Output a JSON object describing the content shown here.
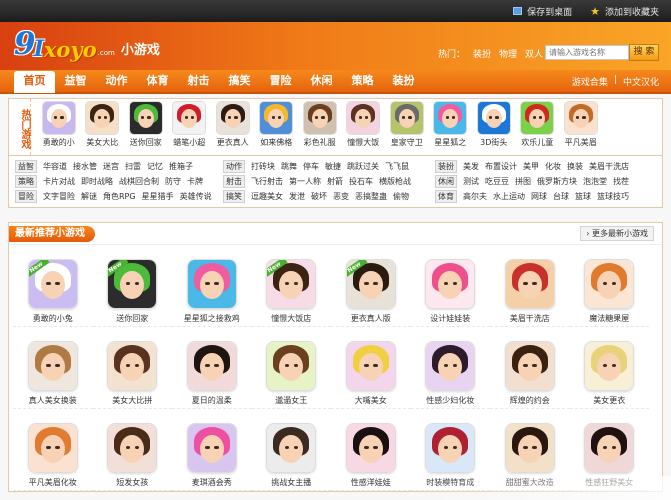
{
  "topbar": {
    "save_desktop": "保存到桌面",
    "add_favorite": "添加到收藏夹"
  },
  "logo": {
    "cn": "小游戏",
    "com": ".com"
  },
  "header": {
    "hot_label": "热门：",
    "hot_links": [
      "装扮",
      "物理",
      "双人"
    ],
    "search_placeholder": "请输入游戏名称",
    "search_button": "搜 索"
  },
  "nav": {
    "items": [
      "首页",
      "益智",
      "动作",
      "体育",
      "射击",
      "搞笑",
      "冒险",
      "休闲",
      "策略",
      "装扮"
    ],
    "right": [
      "游戏合集",
      "中文汉化"
    ]
  },
  "hot_title": "热门游戏",
  "hot_games": [
    {
      "name": "勇敢的小",
      "bg": "#c9b8f0",
      "hair": "#ffffff"
    },
    {
      "name": "美女大比",
      "bg": "#f4e0c8",
      "hair": "#3b2414"
    },
    {
      "name": "送你回家",
      "bg": "#2b2b2b",
      "hair": "#4dbb3a"
    },
    {
      "name": "蜡笔小超",
      "bg": "#f2f2f2",
      "hair": "#d21b2b"
    },
    {
      "name": "更衣真人",
      "bg": "#e9e2da",
      "hair": "#2d1a10"
    },
    {
      "name": "如来佛格",
      "bg": "#4e8fd8",
      "hair": "#f5b82a"
    },
    {
      "name": "彩色礼服",
      "bg": "#d0c0b0",
      "hair": "#6b3e20"
    },
    {
      "name": "憧憬大饭",
      "bg": "#f3d3e0",
      "hair": "#5a3420"
    },
    {
      "name": "皇家守卫",
      "bg": "#b5c36a",
      "hair": "#6a6a6a"
    },
    {
      "name": "星星狐之",
      "bg": "#4bb9e8",
      "hair": "#ef5da0"
    },
    {
      "name": "3D街头",
      "bg": "#1b78d6",
      "hair": "#ffffff"
    },
    {
      "name": "欢乐儿童",
      "bg": "#7dd14a",
      "hair": "#d2291f"
    },
    {
      "name": "平凡美眉",
      "bg": "#fbe2d0",
      "hair": "#c46a28"
    }
  ],
  "categories": [
    [
      {
        "tag": "益智",
        "links": [
          "华容道",
          "接水管",
          "迷宫",
          "扫雷",
          "记忆",
          "推箱子"
        ]
      },
      {
        "tag": "策略",
        "links": [
          "卡片对战",
          "即时战略",
          "战棋回合制",
          "防守",
          "卡牌"
        ]
      },
      {
        "tag": "冒险",
        "links": [
          "文字冒险",
          "解谜",
          "角色RPG",
          "星星猎手",
          "英雄传说"
        ]
      }
    ],
    [
      {
        "tag": "动作",
        "links": [
          "打砖块",
          "跳舞",
          "停车",
          "敏捷",
          "跳跃过关",
          "飞飞鼠"
        ]
      },
      {
        "tag": "射击",
        "links": [
          "飞行射击",
          "第一人称",
          "射箭",
          "投石车",
          "横版枪战"
        ]
      },
      {
        "tag": "搞笑",
        "links": [
          "逗趣美女",
          "发泄",
          "破坏",
          "恶变",
          "恶搞整蛊",
          "偷物"
        ]
      }
    ],
    [
      {
        "tag": "装扮",
        "links": [
          "美发",
          "布置设计",
          "美甲",
          "化妆",
          "换装",
          "美眉干洗店"
        ]
      },
      {
        "tag": "休闲",
        "links": [
          "测试",
          "吃豆豆",
          "拼图",
          "俄罗斯方块",
          "泡泡堂",
          "找茬"
        ]
      },
      {
        "tag": "体育",
        "links": [
          "高尔夫",
          "水上运动",
          "网球",
          "台球",
          "篮球",
          "篮球技巧"
        ]
      }
    ]
  ],
  "recommend": {
    "title": "最新推荐小游戏",
    "more": "更多最新小游戏",
    "games": [
      {
        "name": "勇敢的小兔",
        "bg": "#cbbcf2",
        "hair": "#ffffff",
        "new": "New"
      },
      {
        "name": "送你回家",
        "bg": "#2c2c2c",
        "hair": "#4dbb3a",
        "new": "New"
      },
      {
        "name": "星星狐之接救鸡",
        "bg": "#4bb9e8",
        "hair": "#ef5da0",
        "new": ""
      },
      {
        "name": "憧憬大饭店",
        "bg": "#f7dbe6",
        "hair": "#3b2414",
        "new": "New"
      },
      {
        "name": "更衣真人版",
        "bg": "#e8e1d8",
        "hair": "#2a1a10",
        "new": "New"
      },
      {
        "name": "设计娃娃装",
        "bg": "#fce8ee",
        "hair": "#ef4f8a",
        "new": ""
      },
      {
        "name": "美眉干洗店",
        "bg": "#f5cfa8",
        "hair": "#c9302c",
        "new": ""
      },
      {
        "name": "魔法糖果屋",
        "bg": "#fbe6d6",
        "hair": "#e07a2c",
        "new": ""
      },
      {
        "name": "真人美女换装",
        "bg": "#efe6de",
        "hair": "#b07a45",
        "new": ""
      },
      {
        "name": "美女大比拼",
        "bg": "#f3e2cf",
        "hair": "#5a3220",
        "new": ""
      },
      {
        "name": "夏日的温柔",
        "bg": "#f2dada",
        "hair": "#1f1410",
        "new": ""
      },
      {
        "name": "邋遢女王",
        "bg": "#e6f3c6",
        "hair": "#6a4020",
        "new": ""
      },
      {
        "name": "大嘴美女",
        "bg": "#f3d6ec",
        "hair": "#f0d040",
        "new": ""
      },
      {
        "name": "性感少妇化妆",
        "bg": "#e8d4f2",
        "hair": "#2d1a2a",
        "new": ""
      },
      {
        "name": "辉煌的约会",
        "bg": "#f2dfd0",
        "hair": "#3c2010",
        "new": ""
      },
      {
        "name": "美女更衣",
        "bg": "#f7efd6",
        "hair": "#e8d27a",
        "new": ""
      },
      {
        "name": "平凡美眉化妆",
        "bg": "#fbe1d0",
        "hair": "#e07b30",
        "new": ""
      },
      {
        "name": "短发女孩",
        "bg": "#f2e0d8",
        "hair": "#4a2a18",
        "new": ""
      },
      {
        "name": "麦琪酒会秀",
        "bg": "#d8c6f0",
        "hair": "#ee4fa0",
        "new": ""
      },
      {
        "name": "挑战女主播",
        "bg": "#ececec",
        "hair": "#3a2a20",
        "new": ""
      },
      {
        "name": "性感洋娃娃",
        "bg": "#f8d8e4",
        "hair": "#1a1010",
        "new": ""
      },
      {
        "name": "时装模特育成",
        "bg": "#d8e8f8",
        "hair": "#b02030",
        "new": ""
      },
      {
        "name": "甜甜蜜大改造",
        "bg": "#f2e0c8",
        "hair": "#2a1810",
        "new": ""
      },
      {
        "name": "性感狂野美女",
        "bg": "#f0d8d8",
        "hair": "#201010",
        "new": ""
      }
    ]
  },
  "colors": {
    "accent": "#e35a0b",
    "logo_blue": "#1b78d6"
  }
}
